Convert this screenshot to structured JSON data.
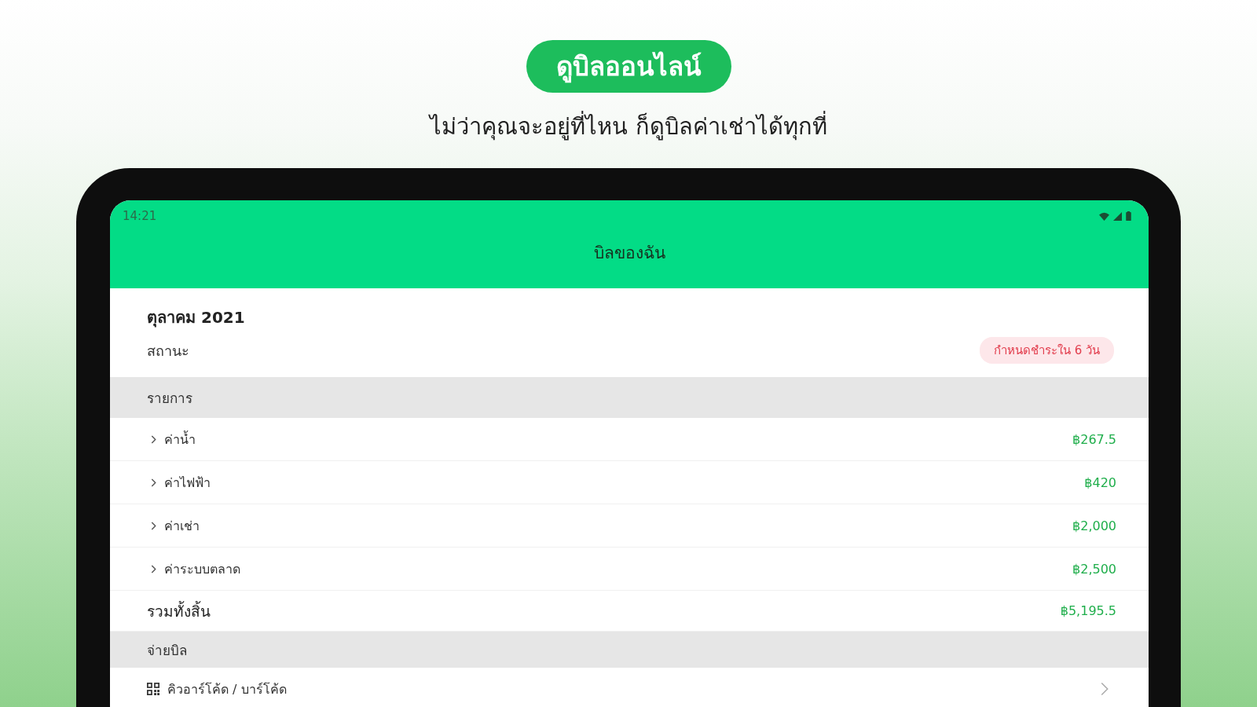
{
  "banner": {
    "headline": "ดูบิลออนไลน์",
    "subtitle": "ไม่ว่าคุณจะอยู่ที่ไหน ก็ดูบิลค่าเช่าได้ทุกที่"
  },
  "status_bar": {
    "time": "14:21"
  },
  "app_bar": {
    "title": "บิลของฉัน"
  },
  "bill": {
    "month": "ตุลาคม 2021",
    "status_label": "สถานะ",
    "status_badge": "กำหนดชำระใน 6 วัน"
  },
  "items_section": {
    "heading": "รายการ",
    "items": [
      {
        "name": "ค่าน้ำ",
        "amount": "฿267.5",
        "expanded": false
      },
      {
        "name": "ค่าไฟฟ้า",
        "amount": "฿420",
        "expanded": false
      },
      {
        "name": "ค่าเช่า",
        "amount": "฿2,000",
        "expanded": false
      },
      {
        "name": "ค่าระบบตลาด",
        "amount": "฿2,500",
        "expanded": false
      }
    ],
    "total": {
      "label": "รวมทั้งสิ้น",
      "amount": "฿5,195.5"
    }
  },
  "pay_section": {
    "heading": "จ่ายบิล",
    "options": [
      {
        "label": "คิวอาร์โค้ด / บาร์โค้ด"
      }
    ]
  }
}
